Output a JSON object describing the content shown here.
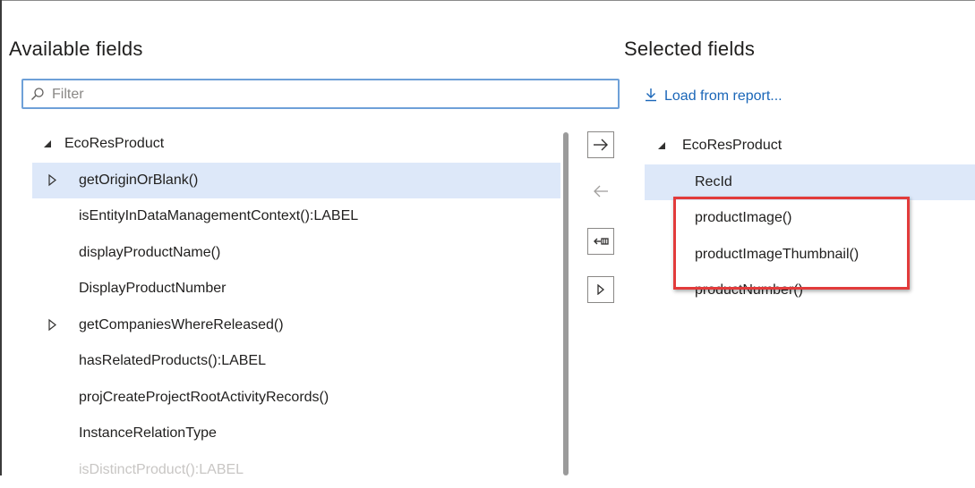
{
  "available": {
    "heading": "Available fields",
    "filter_placeholder": "Filter",
    "items": [
      {
        "label": "EcoResProduct",
        "type": "root"
      },
      {
        "label": "getOriginOrBlank()",
        "type": "expandable",
        "selected": true
      },
      {
        "label": "isEntityInDataManagementContext():LABEL",
        "type": "leaf"
      },
      {
        "label": "displayProductName()",
        "type": "leaf"
      },
      {
        "label": "DisplayProductNumber",
        "type": "leaf"
      },
      {
        "label": "getCompaniesWhereReleased()",
        "type": "expandable"
      },
      {
        "label": "hasRelatedProducts():LABEL",
        "type": "leaf"
      },
      {
        "label": "projCreateProjectRootActivityRecords()",
        "type": "leaf"
      },
      {
        "label": "InstanceRelationType",
        "type": "leaf"
      },
      {
        "label": "isDistinctProduct():LABEL",
        "type": "leaf",
        "faded": true
      }
    ]
  },
  "selected": {
    "heading": "Selected fields",
    "load_link": "Load from report...",
    "items": [
      {
        "label": "EcoResProduct",
        "type": "root"
      },
      {
        "label": "RecId",
        "type": "leaf",
        "selected": true
      },
      {
        "label": "productImage()",
        "type": "leaf"
      },
      {
        "label": "productImageThumbnail()",
        "type": "leaf"
      },
      {
        "label": "productNumber()",
        "type": "leaf"
      }
    ]
  },
  "buttons": {
    "add": {
      "icon": "arrow-right-icon",
      "enabled": true
    },
    "remove": {
      "icon": "arrow-left-icon",
      "enabled": false
    },
    "remove_all": {
      "icon": "arrow-left-bar-icon",
      "enabled": true
    },
    "add_all": {
      "icon": "caret-right-icon",
      "enabled": true
    }
  },
  "colors": {
    "accent": "#1a66b8",
    "selection": "#dde8f9",
    "highlight": "#e23b3b",
    "focus_border": "#6ea0d8"
  }
}
